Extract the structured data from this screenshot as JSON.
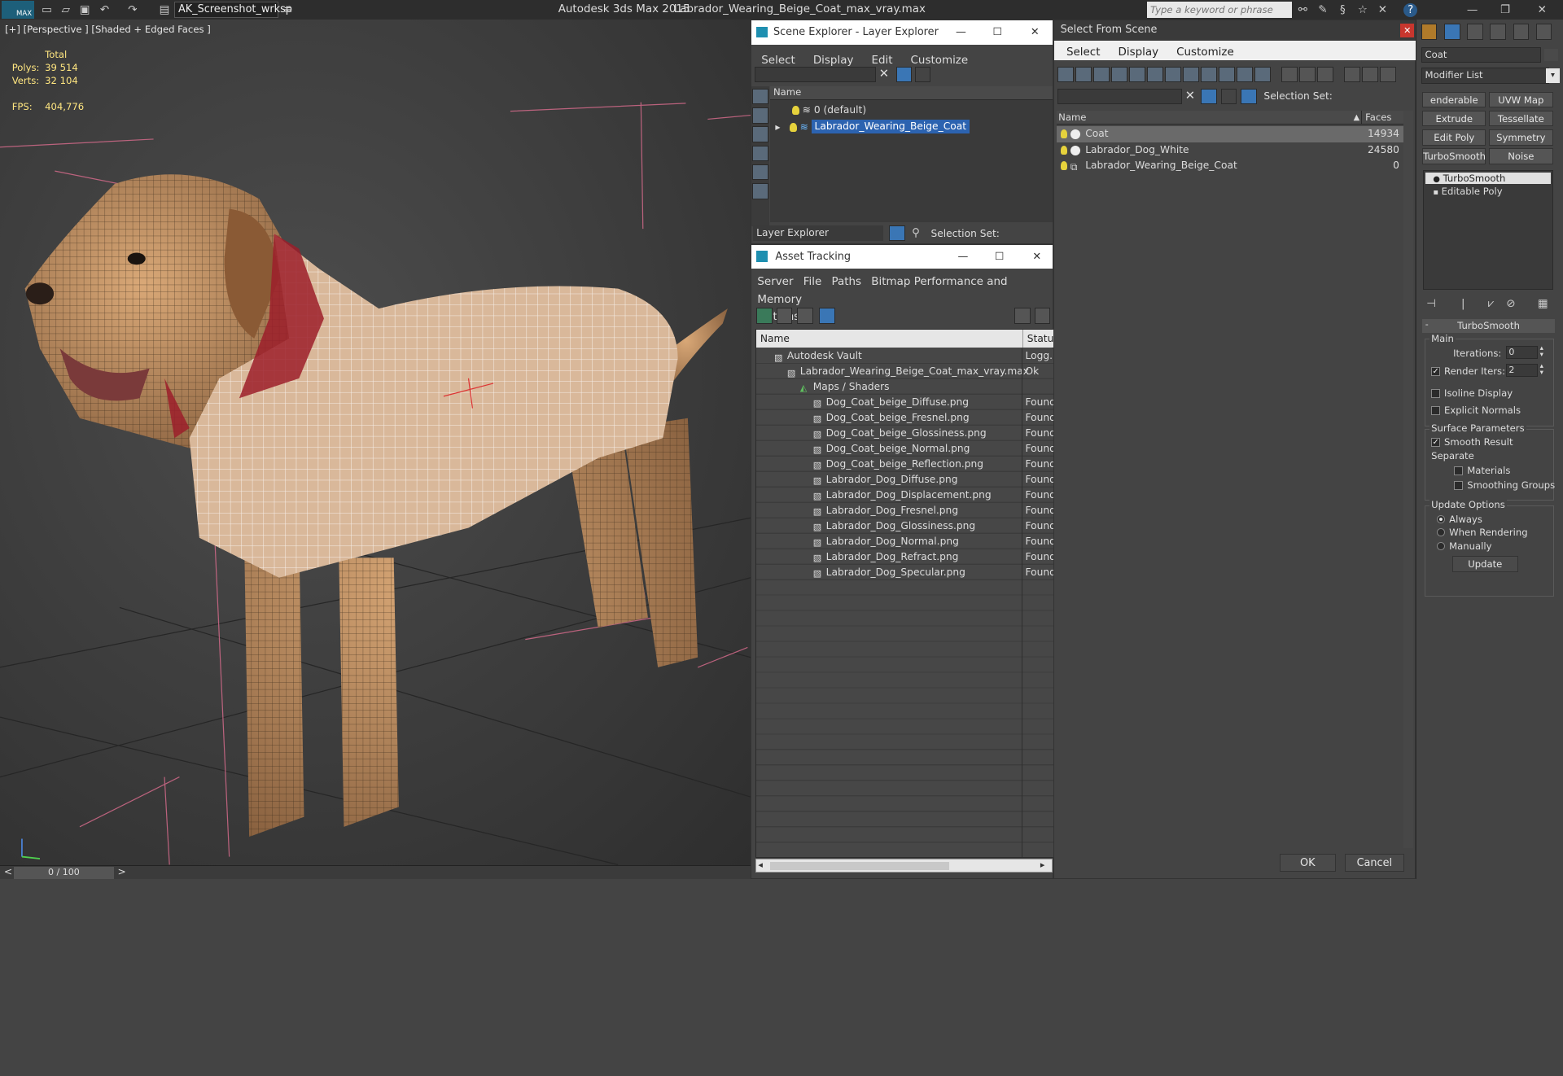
{
  "app": {
    "title": "Autodesk 3ds Max  2015",
    "file": "Labrador_Wearing_Beige_Coat_max_vray.max",
    "workspace": "AK_Screenshot_wrksp",
    "search_placeholder": "Type a keyword or phrase",
    "logo": "MAX"
  },
  "viewport": {
    "label": "[+] [Perspective ] [Shaded + Edged Faces ]",
    "stats_total": "Total",
    "polys_label": "Polys:",
    "polys_value": "39 514",
    "verts_label": "Verts:",
    "verts_value": "32 104",
    "fps_label": "FPS:",
    "fps_value": "404,776",
    "timeline": "0 / 100",
    "time_prev": "<",
    "time_next": ">"
  },
  "scene_explorer": {
    "title": "Scene Explorer - Layer Explorer",
    "menu": [
      "Select",
      "Display",
      "Edit",
      "Customize"
    ],
    "col_name": "Name",
    "rows": [
      "0 (default)",
      "Labrador_Wearing_Beige_Coat"
    ],
    "footer_combo": "Layer Explorer",
    "selection_set": "Selection Set:"
  },
  "asset_tracking": {
    "title": "Asset Tracking",
    "menu": [
      "Server",
      "File",
      "Paths",
      "Bitmap Performance and Memory",
      "Options"
    ],
    "col_name": "Name",
    "col_status": "Status",
    "rows": [
      {
        "name": "Autodesk Vault",
        "status": "Logg..",
        "indent": 0
      },
      {
        "name": "Labrador_Wearing_Beige_Coat_max_vray.max",
        "status": "Ok",
        "indent": 1
      },
      {
        "name": "Maps / Shaders",
        "status": "",
        "indent": 2
      },
      {
        "name": "Dog_Coat_beige_Diffuse.png",
        "status": "Found",
        "indent": 3
      },
      {
        "name": "Dog_Coat_beige_Fresnel.png",
        "status": "Found",
        "indent": 3
      },
      {
        "name": "Dog_Coat_beige_Glossiness.png",
        "status": "Found",
        "indent": 3
      },
      {
        "name": "Dog_Coat_beige_Normal.png",
        "status": "Found",
        "indent": 3
      },
      {
        "name": "Dog_Coat_beige_Reflection.png",
        "status": "Found",
        "indent": 3
      },
      {
        "name": "Labrador_Dog_Diffuse.png",
        "status": "Found",
        "indent": 3
      },
      {
        "name": "Labrador_Dog_Displacement.png",
        "status": "Found",
        "indent": 3
      },
      {
        "name": "Labrador_Dog_Fresnel.png",
        "status": "Found",
        "indent": 3
      },
      {
        "name": "Labrador_Dog_Glossiness.png",
        "status": "Found",
        "indent": 3
      },
      {
        "name": "Labrador_Dog_Normal.png",
        "status": "Found",
        "indent": 3
      },
      {
        "name": "Labrador_Dog_Refract.png",
        "status": "Found",
        "indent": 3
      },
      {
        "name": "Labrador_Dog_Specular.png",
        "status": "Found",
        "indent": 3
      }
    ]
  },
  "select_from_scene": {
    "title": "Select From Scene",
    "menu": [
      "Select",
      "Display",
      "Customize"
    ],
    "selection_set": "Selection Set:",
    "col_name": "Name",
    "col_faces": "Faces",
    "rows": [
      {
        "name": "Coat",
        "faces": "14934"
      },
      {
        "name": "Labrador_Dog_White",
        "faces": "24580"
      },
      {
        "name": "Labrador_Wearing_Beige_Coat",
        "faces": "0"
      }
    ],
    "ok": "OK",
    "cancel": "Cancel"
  },
  "modify": {
    "object_name": "Coat",
    "modifier_list": "Modifier List",
    "buttons": [
      "enderable Spli",
      "UVW Map",
      "Extrude",
      "Tessellate",
      "Edit Poly",
      "Symmetry",
      "TurboSmooth",
      "Noise"
    ],
    "stack": [
      "TurboSmooth",
      "Editable Poly"
    ],
    "rollout": "TurboSmooth",
    "main": "Main",
    "iterations_label": "Iterations:",
    "iterations": "0",
    "render_iters_label": "Render Iters:",
    "render_iters": "2",
    "isoline": "Isoline Display",
    "explicit": "Explicit Normals",
    "surface": "Surface Parameters",
    "smooth": "Smooth Result",
    "separate": "Separate",
    "materials": "Materials",
    "smoothing": "Smoothing Groups",
    "update_options": "Update Options",
    "always": "Always",
    "when_rendering": "When Rendering",
    "manually": "Manually",
    "update": "Update"
  }
}
